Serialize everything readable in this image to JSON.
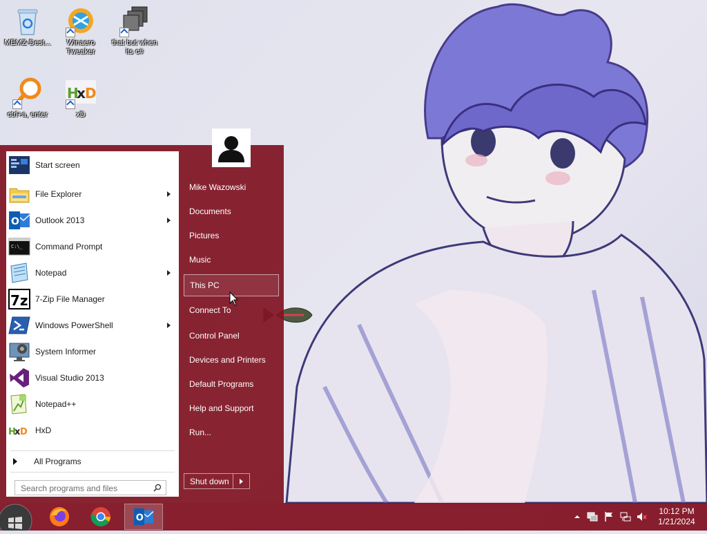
{
  "desktop": {
    "icons": [
      {
        "label": "MEMZ-Dest..."
      },
      {
        "label": "Winaero Tweaker"
      },
      {
        "label": "that but when its c#"
      },
      {
        "label": "ctrl+a, enter"
      },
      {
        "label": "xD"
      }
    ]
  },
  "start_menu": {
    "programs": [
      {
        "label": "Start screen",
        "icon": "start-screen-icon",
        "has_submenu": false
      },
      {
        "label": "File Explorer",
        "icon": "folder-icon",
        "has_submenu": true
      },
      {
        "label": "Outlook 2013",
        "icon": "outlook-icon",
        "has_submenu": true
      },
      {
        "label": "Command Prompt",
        "icon": "terminal-icon",
        "has_submenu": false
      },
      {
        "label": "Notepad",
        "icon": "notepad-icon",
        "has_submenu": true
      },
      {
        "label": "7-Zip File Manager",
        "icon": "7zip-icon",
        "has_submenu": false
      },
      {
        "label": "Windows PowerShell",
        "icon": "powershell-icon",
        "has_submenu": true
      },
      {
        "label": "System Informer",
        "icon": "system-informer-icon",
        "has_submenu": false
      },
      {
        "label": "Visual Studio 2013",
        "icon": "visual-studio-icon",
        "has_submenu": false
      },
      {
        "label": "Notepad++",
        "icon": "notepadpp-icon",
        "has_submenu": false
      },
      {
        "label": "HxD",
        "icon": "hxd-icon",
        "has_submenu": false
      }
    ],
    "all_programs_label": "All Programs",
    "search_placeholder": "Search programs and files",
    "right_links": [
      {
        "label": "Mike Wazowski"
      },
      {
        "label": "Documents"
      },
      {
        "label": "Pictures"
      },
      {
        "label": "Music"
      },
      {
        "label": "This PC"
      },
      {
        "label": "Connect To"
      },
      {
        "label": "Control Panel"
      },
      {
        "label": "Devices and Printers"
      },
      {
        "label": "Default Programs"
      },
      {
        "label": "Help and Support"
      },
      {
        "label": "Run..."
      }
    ],
    "hovered_link": "This PC",
    "shutdown_label": "Shut down"
  },
  "taskbar": {
    "pinned": [
      "firefox-icon",
      "chrome-icon",
      "outlook-icon"
    ],
    "active_app": "outlook-icon",
    "tray_icons": [
      "show-hidden-icons-icon",
      "action-center-icon",
      "flag-icon",
      "network-icon",
      "volume-muted-icon"
    ],
    "time": "10:12 PM",
    "date": "1/21/2024"
  },
  "colors": {
    "accent": "#801422",
    "taskbar": "#82142a",
    "menu_left_bg": "#ffffff"
  }
}
